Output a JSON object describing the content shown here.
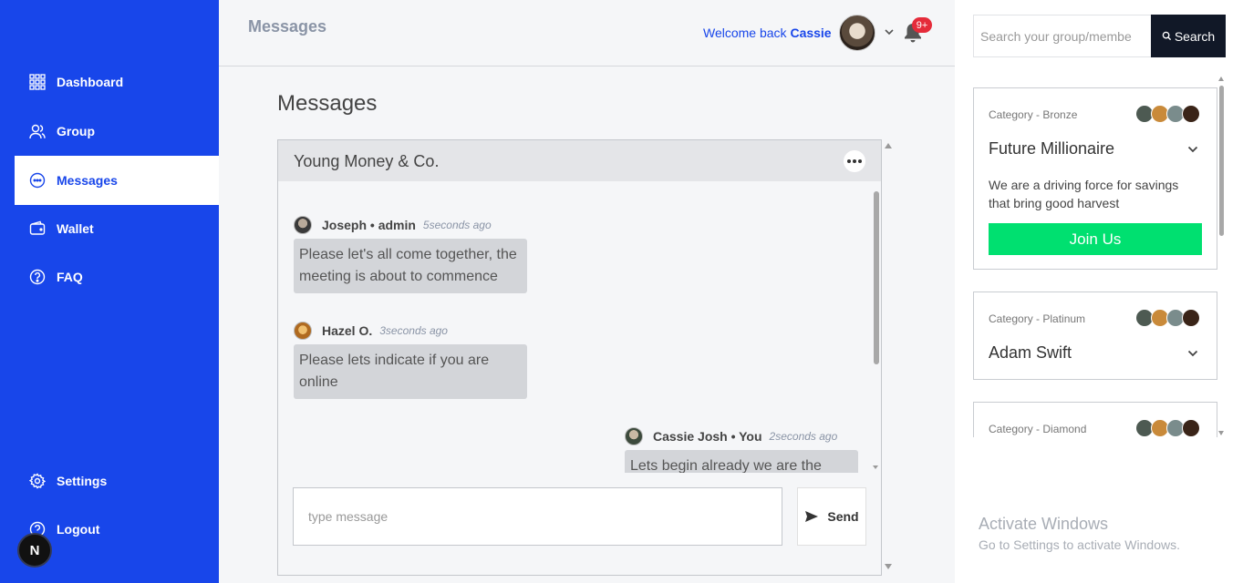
{
  "sidebar": {
    "items": [
      {
        "label": "Dashboard",
        "icon": "grid-icon"
      },
      {
        "label": "Group",
        "icon": "users-icon"
      },
      {
        "label": "Messages",
        "icon": "chat-icon"
      },
      {
        "label": "Wallet",
        "icon": "wallet-icon"
      },
      {
        "label": "FAQ",
        "icon": "question-icon"
      }
    ],
    "settings_label": "Settings",
    "logout_label": "Logout",
    "n_badge": "N"
  },
  "header": {
    "title": "Messages",
    "welcome_prefix": "Welcome back",
    "user_name": "Cassie",
    "notification_count": "9+"
  },
  "main": {
    "title": "Messages",
    "chat": {
      "group_name": "Young Money & Co.",
      "messages": [
        {
          "author": "Joseph • admin",
          "time": "5seconds ago",
          "text": "Please let's all come together, the meeting is about to commence"
        },
        {
          "author": "Hazel O.",
          "time": "3seconds ago",
          "text": "Please lets indicate if you are online"
        },
        {
          "author": "Cassie Josh • You",
          "time": "2seconds ago",
          "text": "Lets begin already we are the"
        }
      ],
      "input_placeholder": "type message",
      "send_label": "Send"
    }
  },
  "right_panel": {
    "search_placeholder": "Search your group/membe",
    "search_label": "Search",
    "groups": [
      {
        "category": "Category - Bronze",
        "name": "Future Millionaire",
        "description": "We are a driving force for savings that bring good harvest",
        "join_label": "Join Us"
      },
      {
        "category": "Category - Platinum",
        "name": "Adam Swift"
      },
      {
        "category": "Category - Diamond"
      }
    ]
  },
  "watermark": {
    "title": "Activate Windows",
    "subtitle": "Go to Settings to activate Windows."
  },
  "colors": {
    "brand": "#1846ea",
    "join": "#00e070",
    "search_button": "#111827",
    "notification": "#e52b3a"
  }
}
